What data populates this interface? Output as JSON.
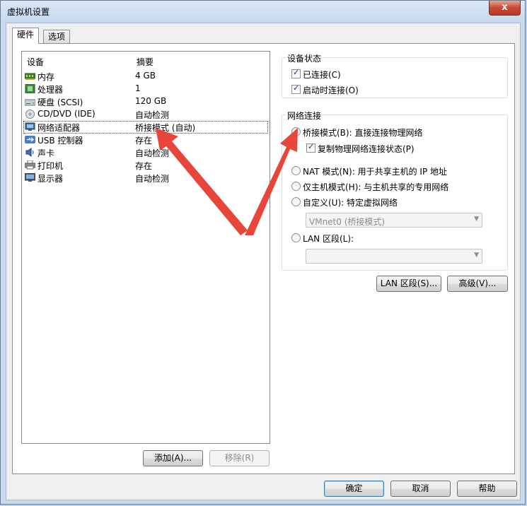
{
  "window": {
    "title": "虚拟机设置",
    "close_label": "x"
  },
  "tabs": [
    {
      "label": "硬件"
    },
    {
      "label": "选项"
    }
  ],
  "device_list": {
    "col_device": "设备",
    "col_summary": "摘要",
    "rows": [
      {
        "name": "内存",
        "summary": "4 GB",
        "icon": "memory-icon"
      },
      {
        "name": "处理器",
        "summary": "1",
        "icon": "processor-icon"
      },
      {
        "name": "硬盘 (SCSI)",
        "summary": "120 GB",
        "icon": "hard-disk-icon"
      },
      {
        "name": "CD/DVD (IDE)",
        "summary": "自动检测",
        "icon": "cd-dvd-icon"
      },
      {
        "name": "网络适配器",
        "summary": "桥接模式 (自动)",
        "icon": "network-adapter-icon"
      },
      {
        "name": "USB 控制器",
        "summary": "存在",
        "icon": "usb-icon"
      },
      {
        "name": "声卡",
        "summary": "自动检测",
        "icon": "sound-card-icon"
      },
      {
        "name": "打印机",
        "summary": "存在",
        "icon": "printer-icon"
      },
      {
        "name": "显示器",
        "summary": "自动检测",
        "icon": "display-icon"
      }
    ],
    "selected_index": 4
  },
  "buttons": {
    "add": "添加(A)...",
    "remove": "移除(R)",
    "lan_segments": "LAN 区段(S)...",
    "advanced": "高级(V)...",
    "ok": "确定",
    "cancel": "取消",
    "help": "帮助"
  },
  "device_status": {
    "title": "设备状态",
    "connected": {
      "label": "已连接(C)",
      "checked": true
    },
    "connect_at_power_on": {
      "label": "启动时连接(O)",
      "checked": true
    }
  },
  "network_connection": {
    "title": "网络连接",
    "bridged": {
      "label": "桥接模式(B): 直接连接物理网络",
      "selected": true
    },
    "replicate": {
      "label": "复制物理网络连接状态(P)",
      "checked": true
    },
    "nat": {
      "label": "NAT 模式(N): 用于共享主机的 IP 地址",
      "selected": false
    },
    "host_only": {
      "label": "仅主机模式(H): 与主机共享的专用网络",
      "selected": false
    },
    "custom": {
      "label": "自定义(U): 特定虚拟网络",
      "selected": false
    },
    "custom_select_value": "VMnet0 (桥接模式)",
    "lan_segment": {
      "label": "LAN 区段(L):",
      "selected": false
    },
    "lan_select_value": ""
  },
  "colors": {
    "accent_red": "#e8463a",
    "window_frame": "#c8daf0",
    "selection_dotted": "#444444"
  }
}
